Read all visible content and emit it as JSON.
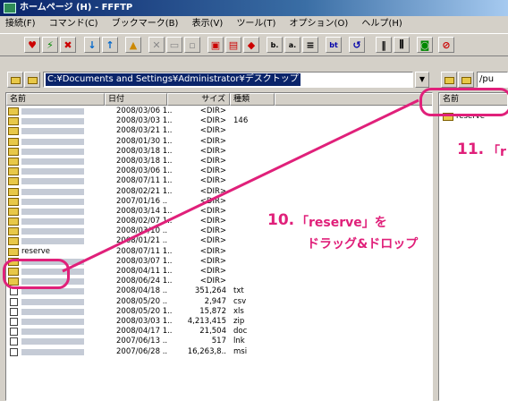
{
  "window": {
    "title": "ホームページ (H) - FFFTP"
  },
  "menu": [
    "接続(F)",
    "コマンド(C)",
    "ブックマーク(B)",
    "表示(V)",
    "ツール(T)",
    "オプション(O)",
    "ヘルプ(H)"
  ],
  "toolbar_icons": [
    "connect-icon",
    "disconnect-icon",
    "bookmark-icon",
    "download-icon",
    "upload-icon",
    "up-folder-icon",
    "delete-icon",
    "rename-icon",
    "mkdir-icon",
    "view-icon",
    "refresh-icon",
    "settings-icon",
    "filter-icon",
    "sort-icon",
    "list-icon",
    "detail-icon",
    "disk-icon",
    "stop-icon"
  ],
  "local": {
    "path": "C:¥Documents and Settings¥Administrator¥デスクトップ",
    "columns": [
      "名前",
      "日付",
      "サイズ",
      "種類"
    ],
    "rows": [
      {
        "name": "",
        "type": "folder",
        "date": "2008/03/06 1..",
        "size": "<DIR>",
        "ext": ""
      },
      {
        "name": "",
        "type": "folder",
        "date": "2008/03/03 1..",
        "size": "<DIR>",
        "ext": "146"
      },
      {
        "name": "",
        "type": "folder",
        "date": "2008/03/21 1..",
        "size": "<DIR>",
        "ext": ""
      },
      {
        "name": "",
        "type": "folder",
        "date": "2008/01/30 1..",
        "size": "<DIR>",
        "ext": ""
      },
      {
        "name": "",
        "type": "folder",
        "date": "2008/03/18 1..",
        "size": "<DIR>",
        "ext": ""
      },
      {
        "name": "",
        "type": "folder",
        "date": "2008/03/18 1..",
        "size": "<DIR>",
        "ext": ""
      },
      {
        "name": "",
        "type": "folder",
        "date": "2008/03/06 1..",
        "size": "<DIR>",
        "ext": ""
      },
      {
        "name": "",
        "type": "folder",
        "date": "2008/07/11 1..",
        "size": "<DIR>",
        "ext": ""
      },
      {
        "name": "",
        "type": "folder",
        "date": "2008/02/21 1..",
        "size": "<DIR>",
        "ext": ""
      },
      {
        "name": "",
        "type": "folder",
        "date": "2007/01/16 ..",
        "size": "<DIR>",
        "ext": ""
      },
      {
        "name": "",
        "type": "folder",
        "date": "2008/03/14 1..",
        "size": "<DIR>",
        "ext": ""
      },
      {
        "name": "",
        "type": "folder",
        "date": "2008/02/07 1..",
        "size": "<DIR>",
        "ext": ""
      },
      {
        "name": "",
        "type": "folder",
        "date": "2008/03/10 ..",
        "size": "<DIR>",
        "ext": ""
      },
      {
        "name": "",
        "type": "folder",
        "date": "2008/01/21 ..",
        "size": "<DIR>",
        "ext": ""
      },
      {
        "name": "reserve",
        "type": "folder",
        "date": "2008/07/11 1..",
        "size": "<DIR>",
        "ext": ""
      },
      {
        "name": "",
        "type": "folder",
        "date": "2008/03/07 1..",
        "size": "<DIR>",
        "ext": ""
      },
      {
        "name": "",
        "type": "folder",
        "date": "2008/04/11 1..",
        "size": "<DIR>",
        "ext": ""
      },
      {
        "name": "",
        "type": "folder",
        "date": "2008/06/24 1..",
        "size": "<DIR>",
        "ext": ""
      },
      {
        "name": "",
        "type": "file",
        "date": "2008/04/18 ..",
        "size": "351,264",
        "ext": "txt"
      },
      {
        "name": "",
        "type": "file",
        "date": "2008/05/20 ..",
        "size": "2,947",
        "ext": "csv"
      },
      {
        "name": "",
        "type": "file",
        "date": "2008/05/20 1..",
        "size": "15,872",
        "ext": "xls"
      },
      {
        "name": "",
        "type": "file",
        "date": "2008/03/03 1..",
        "size": "4,213,415",
        "ext": "zip"
      },
      {
        "name": "",
        "type": "file",
        "date": "2008/04/17 1..",
        "size": "21,504",
        "ext": "doc"
      },
      {
        "name": "",
        "type": "file",
        "date": "2007/06/13 ..",
        "size": "517",
        "ext": "lnk"
      },
      {
        "name": "",
        "type": "file",
        "date": "2007/06/28 ..",
        "size": "16,263,8..",
        "ext": "msi"
      }
    ]
  },
  "remote": {
    "path": "/pu",
    "columns": [
      "名前"
    ],
    "item": "reserve"
  },
  "annotations": {
    "step10_num": "10.",
    "step10_line1": "「reserve」を",
    "step10_line2": "ドラッグ&ドロップ",
    "step11_num": "11.",
    "step11_text": "「r"
  },
  "colors": {
    "accent": "#e0207a",
    "title_bar": "#0a246a",
    "selection": "#0a246a"
  }
}
